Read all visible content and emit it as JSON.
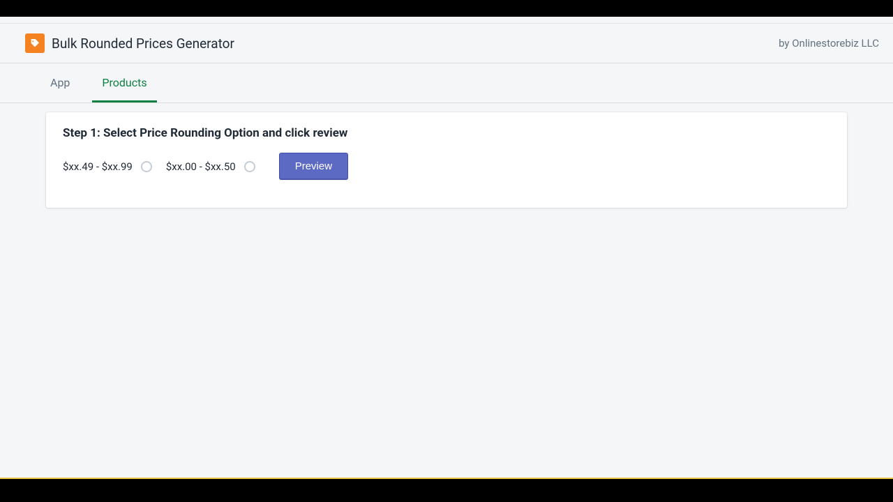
{
  "header": {
    "app_title": "Bulk Rounded Prices Generator",
    "byline": "by Onlinestorebiz LLC"
  },
  "tabs": {
    "app": "App",
    "products": "Products"
  },
  "card": {
    "step_title": "Step 1: Select Price Rounding Option and click review",
    "option1": "$xx.49 - $xx.99",
    "option2": "$xx.00 - $xx.50",
    "preview_label": "Preview"
  }
}
